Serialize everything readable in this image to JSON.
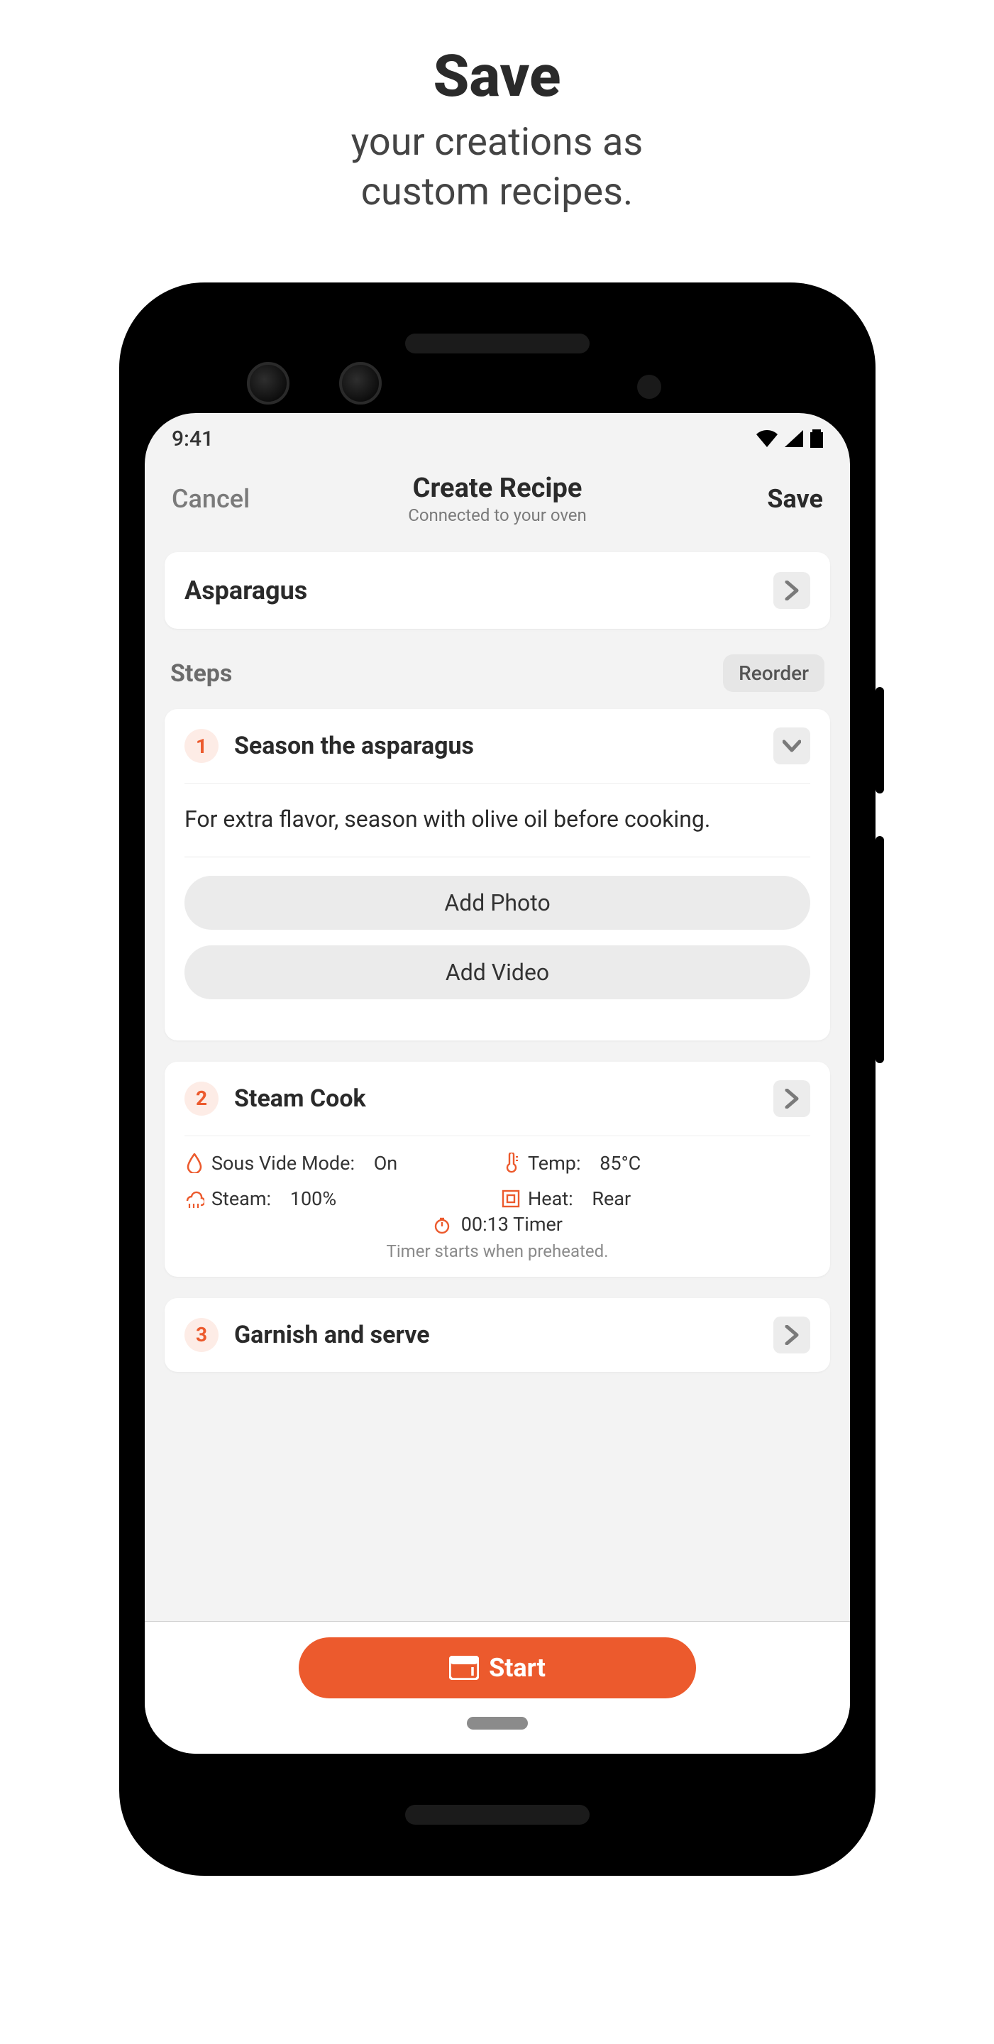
{
  "promo": {
    "title": "Save",
    "subtitle_line1": "your creations as",
    "subtitle_line2": "custom recipes."
  },
  "status": {
    "time": "9:41"
  },
  "nav": {
    "cancel": "Cancel",
    "title": "Create Recipe",
    "subtitle": "Connected to your oven",
    "save": "Save"
  },
  "recipe": {
    "name": "Asparagus"
  },
  "steps_section": {
    "label": "Steps",
    "reorder": "Reorder"
  },
  "steps": [
    {
      "num": "1",
      "title": "Season the asparagus",
      "description": "For extra flavor, season with olive oil before cooking.",
      "add_photo": "Add Photo",
      "add_video": "Add Video"
    },
    {
      "num": "2",
      "title": "Steam Cook",
      "settings": {
        "sous_vide_label": "Sous Vide Mode:",
        "sous_vide_value": "On",
        "temp_label": "Temp:",
        "temp_value": "85°C",
        "steam_label": "Steam:",
        "steam_value": "100%",
        "heat_label": "Heat:",
        "heat_value": "Rear",
        "timer_label": "00:13 Timer",
        "timer_note": "Timer starts when preheated."
      }
    },
    {
      "num": "3",
      "title": "Garnish and serve"
    }
  ],
  "actions": {
    "start": "Start"
  },
  "colors": {
    "accent": "#ec5a2d"
  }
}
